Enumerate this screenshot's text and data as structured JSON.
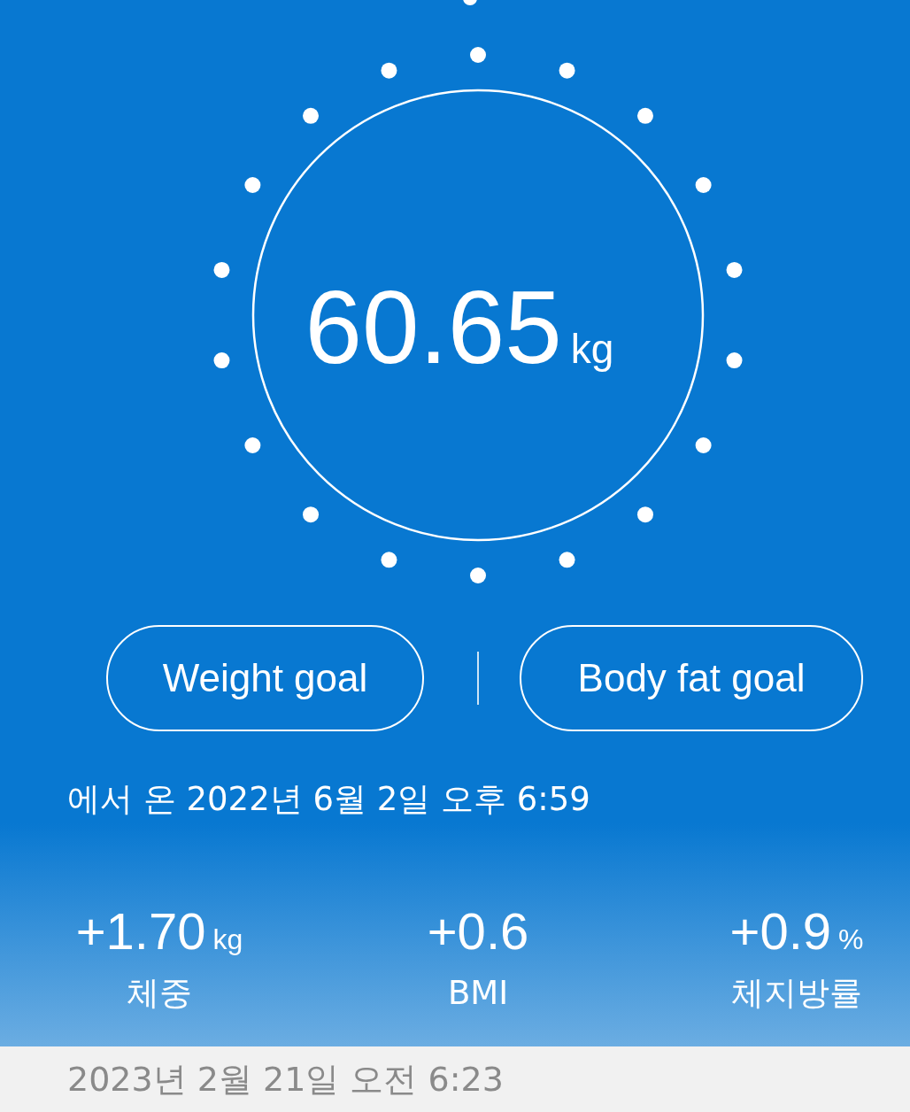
{
  "measurement": {
    "value": "60.65",
    "unit": "kg"
  },
  "goals": [
    {
      "label": "Weight goal"
    },
    {
      "label": "Body fat goal"
    }
  ],
  "sync_text": "에서 온 2022년 6월 2일 오후 6:59",
  "changes": [
    {
      "value": "+1.70",
      "unit": "kg",
      "label": "체중"
    },
    {
      "value": "+0.6",
      "label": "BMI"
    },
    {
      "value": "+0.9",
      "unit": "%",
      "label": "체지방률"
    }
  ],
  "next_entry": {
    "date": "2023년 2월 21일 오전 6:23"
  }
}
